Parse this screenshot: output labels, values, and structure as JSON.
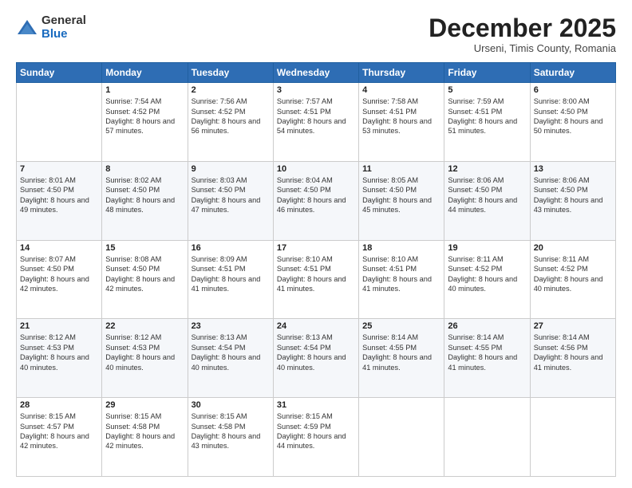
{
  "logo": {
    "general": "General",
    "blue": "Blue"
  },
  "header": {
    "month": "December 2025",
    "location": "Urseni, Timis County, Romania"
  },
  "weekdays": [
    "Sunday",
    "Monday",
    "Tuesday",
    "Wednesday",
    "Thursday",
    "Friday",
    "Saturday"
  ],
  "weeks": [
    [
      {
        "day": "",
        "sunrise": "",
        "sunset": "",
        "daylight": ""
      },
      {
        "day": "1",
        "sunrise": "Sunrise: 7:54 AM",
        "sunset": "Sunset: 4:52 PM",
        "daylight": "Daylight: 8 hours and 57 minutes."
      },
      {
        "day": "2",
        "sunrise": "Sunrise: 7:56 AM",
        "sunset": "Sunset: 4:52 PM",
        "daylight": "Daylight: 8 hours and 56 minutes."
      },
      {
        "day": "3",
        "sunrise": "Sunrise: 7:57 AM",
        "sunset": "Sunset: 4:51 PM",
        "daylight": "Daylight: 8 hours and 54 minutes."
      },
      {
        "day": "4",
        "sunrise": "Sunrise: 7:58 AM",
        "sunset": "Sunset: 4:51 PM",
        "daylight": "Daylight: 8 hours and 53 minutes."
      },
      {
        "day": "5",
        "sunrise": "Sunrise: 7:59 AM",
        "sunset": "Sunset: 4:51 PM",
        "daylight": "Daylight: 8 hours and 51 minutes."
      },
      {
        "day": "6",
        "sunrise": "Sunrise: 8:00 AM",
        "sunset": "Sunset: 4:50 PM",
        "daylight": "Daylight: 8 hours and 50 minutes."
      }
    ],
    [
      {
        "day": "7",
        "sunrise": "Sunrise: 8:01 AM",
        "sunset": "Sunset: 4:50 PM",
        "daylight": "Daylight: 8 hours and 49 minutes."
      },
      {
        "day": "8",
        "sunrise": "Sunrise: 8:02 AM",
        "sunset": "Sunset: 4:50 PM",
        "daylight": "Daylight: 8 hours and 48 minutes."
      },
      {
        "day": "9",
        "sunrise": "Sunrise: 8:03 AM",
        "sunset": "Sunset: 4:50 PM",
        "daylight": "Daylight: 8 hours and 47 minutes."
      },
      {
        "day": "10",
        "sunrise": "Sunrise: 8:04 AM",
        "sunset": "Sunset: 4:50 PM",
        "daylight": "Daylight: 8 hours and 46 minutes."
      },
      {
        "day": "11",
        "sunrise": "Sunrise: 8:05 AM",
        "sunset": "Sunset: 4:50 PM",
        "daylight": "Daylight: 8 hours and 45 minutes."
      },
      {
        "day": "12",
        "sunrise": "Sunrise: 8:06 AM",
        "sunset": "Sunset: 4:50 PM",
        "daylight": "Daylight: 8 hours and 44 minutes."
      },
      {
        "day": "13",
        "sunrise": "Sunrise: 8:06 AM",
        "sunset": "Sunset: 4:50 PM",
        "daylight": "Daylight: 8 hours and 43 minutes."
      }
    ],
    [
      {
        "day": "14",
        "sunrise": "Sunrise: 8:07 AM",
        "sunset": "Sunset: 4:50 PM",
        "daylight": "Daylight: 8 hours and 42 minutes."
      },
      {
        "day": "15",
        "sunrise": "Sunrise: 8:08 AM",
        "sunset": "Sunset: 4:50 PM",
        "daylight": "Daylight: 8 hours and 42 minutes."
      },
      {
        "day": "16",
        "sunrise": "Sunrise: 8:09 AM",
        "sunset": "Sunset: 4:51 PM",
        "daylight": "Daylight: 8 hours and 41 minutes."
      },
      {
        "day": "17",
        "sunrise": "Sunrise: 8:10 AM",
        "sunset": "Sunset: 4:51 PM",
        "daylight": "Daylight: 8 hours and 41 minutes."
      },
      {
        "day": "18",
        "sunrise": "Sunrise: 8:10 AM",
        "sunset": "Sunset: 4:51 PM",
        "daylight": "Daylight: 8 hours and 41 minutes."
      },
      {
        "day": "19",
        "sunrise": "Sunrise: 8:11 AM",
        "sunset": "Sunset: 4:52 PM",
        "daylight": "Daylight: 8 hours and 40 minutes."
      },
      {
        "day": "20",
        "sunrise": "Sunrise: 8:11 AM",
        "sunset": "Sunset: 4:52 PM",
        "daylight": "Daylight: 8 hours and 40 minutes."
      }
    ],
    [
      {
        "day": "21",
        "sunrise": "Sunrise: 8:12 AM",
        "sunset": "Sunset: 4:53 PM",
        "daylight": "Daylight: 8 hours and 40 minutes."
      },
      {
        "day": "22",
        "sunrise": "Sunrise: 8:12 AM",
        "sunset": "Sunset: 4:53 PM",
        "daylight": "Daylight: 8 hours and 40 minutes."
      },
      {
        "day": "23",
        "sunrise": "Sunrise: 8:13 AM",
        "sunset": "Sunset: 4:54 PM",
        "daylight": "Daylight: 8 hours and 40 minutes."
      },
      {
        "day": "24",
        "sunrise": "Sunrise: 8:13 AM",
        "sunset": "Sunset: 4:54 PM",
        "daylight": "Daylight: 8 hours and 40 minutes."
      },
      {
        "day": "25",
        "sunrise": "Sunrise: 8:14 AM",
        "sunset": "Sunset: 4:55 PM",
        "daylight": "Daylight: 8 hours and 41 minutes."
      },
      {
        "day": "26",
        "sunrise": "Sunrise: 8:14 AM",
        "sunset": "Sunset: 4:55 PM",
        "daylight": "Daylight: 8 hours and 41 minutes."
      },
      {
        "day": "27",
        "sunrise": "Sunrise: 8:14 AM",
        "sunset": "Sunset: 4:56 PM",
        "daylight": "Daylight: 8 hours and 41 minutes."
      }
    ],
    [
      {
        "day": "28",
        "sunrise": "Sunrise: 8:15 AM",
        "sunset": "Sunset: 4:57 PM",
        "daylight": "Daylight: 8 hours and 42 minutes."
      },
      {
        "day": "29",
        "sunrise": "Sunrise: 8:15 AM",
        "sunset": "Sunset: 4:58 PM",
        "daylight": "Daylight: 8 hours and 42 minutes."
      },
      {
        "day": "30",
        "sunrise": "Sunrise: 8:15 AM",
        "sunset": "Sunset: 4:58 PM",
        "daylight": "Daylight: 8 hours and 43 minutes."
      },
      {
        "day": "31",
        "sunrise": "Sunrise: 8:15 AM",
        "sunset": "Sunset: 4:59 PM",
        "daylight": "Daylight: 8 hours and 44 minutes."
      },
      {
        "day": "",
        "sunrise": "",
        "sunset": "",
        "daylight": ""
      },
      {
        "day": "",
        "sunrise": "",
        "sunset": "",
        "daylight": ""
      },
      {
        "day": "",
        "sunrise": "",
        "sunset": "",
        "daylight": ""
      }
    ]
  ]
}
